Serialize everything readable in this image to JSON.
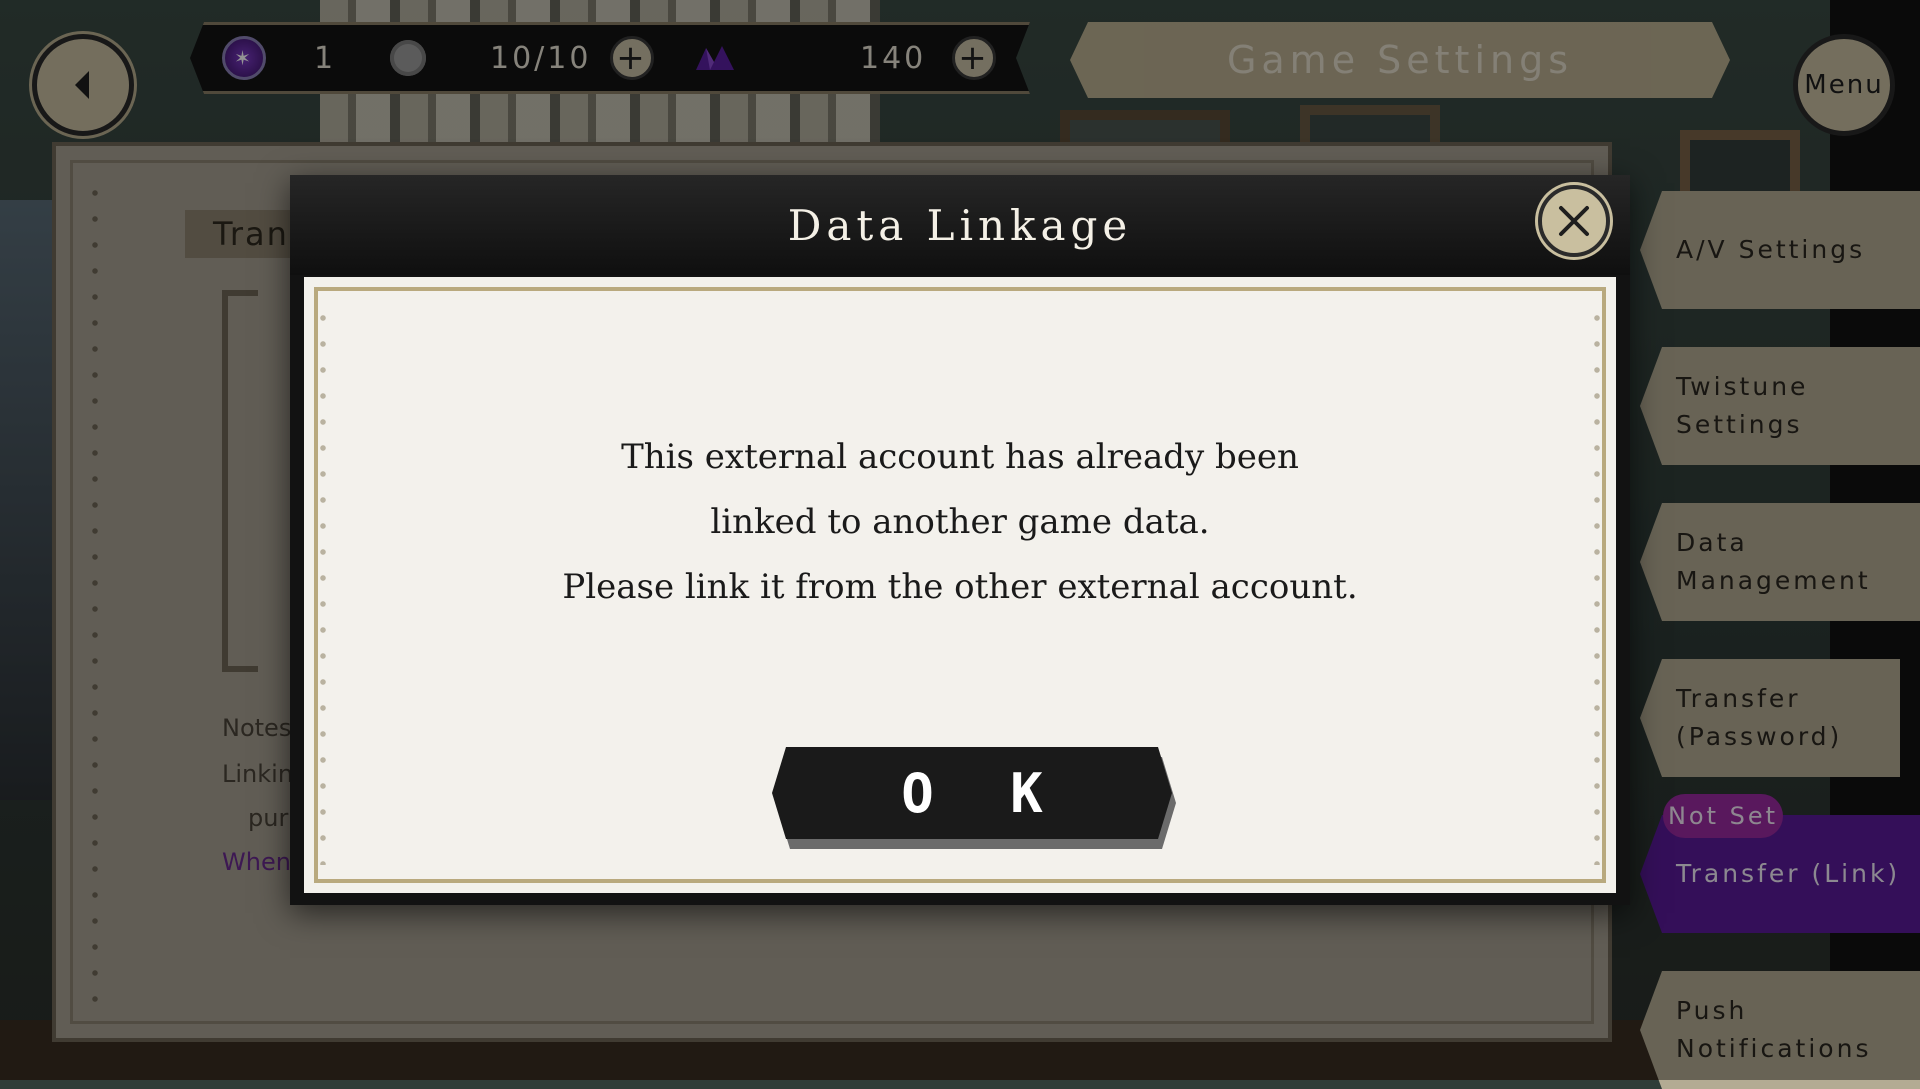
{
  "topbar": {
    "gem_count": "1",
    "stamina": "10/10",
    "crystal_count": "140",
    "title": "Game Settings",
    "menu_label": "Menu"
  },
  "background_panel": {
    "tab_label": "Tran",
    "notes": [
      "Notes:",
      "Linking",
      "purp",
      "When"
    ]
  },
  "side_menu": {
    "items": [
      {
        "label": "A/V Settings"
      },
      {
        "label": "Twistune Settings"
      },
      {
        "label": "Data Management"
      },
      {
        "label": "Transfer (Password)"
      },
      {
        "label": "Transfer (Link)"
      },
      {
        "label": "Push Notifications"
      }
    ],
    "badge": "Not Set"
  },
  "dialog": {
    "title": "Data Linkage",
    "lines": [
      "This external account has already been",
      "linked to another game data.",
      "Please link it from the other external account."
    ],
    "ok_label": "O K"
  },
  "colors": {
    "accent_purple": "#5a1a9a",
    "badge_magenta": "#9a2aa0",
    "tan": "#c2b696",
    "dialog_border": "#b9a97e"
  }
}
